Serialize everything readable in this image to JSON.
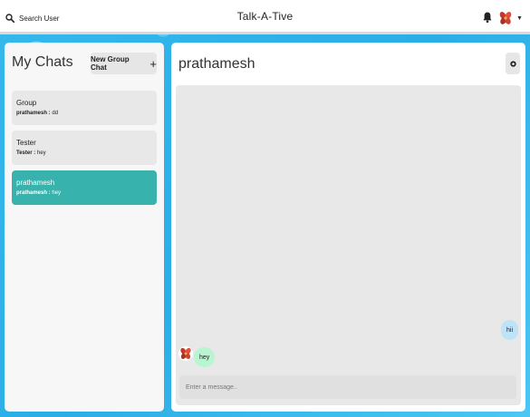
{
  "header": {
    "search_label": "Search User",
    "app_title": "Talk-A-Tive"
  },
  "sidebar": {
    "title": "My Chats",
    "new_group_label": "New Group Chat",
    "new_group_icon": "+",
    "chats": [
      {
        "name": "Group",
        "sender": "prathamesh :",
        "message": "dd",
        "active": false
      },
      {
        "name": "Tester",
        "sender": "Tester :",
        "message": "hey",
        "active": false
      },
      {
        "name": "prathamesh",
        "sender": "prathamesh :",
        "message": "hey",
        "active": true
      }
    ]
  },
  "chat": {
    "title": "prathamesh",
    "messages": [
      {
        "text": "hii",
        "from": "self"
      },
      {
        "text": "hey",
        "from": "other"
      }
    ],
    "input_placeholder": "Enter a message.."
  },
  "colors": {
    "active_chat": "#38b2ac",
    "sent_bubble": "#bee3f8",
    "received_bubble": "#b9f5d0"
  }
}
